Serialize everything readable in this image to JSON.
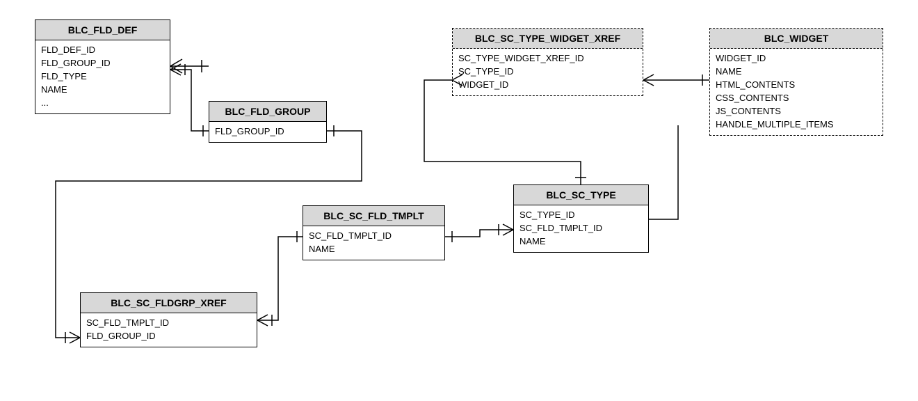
{
  "entities": {
    "fld_def": {
      "title": "BLC_FLD_DEF",
      "fields": [
        "FLD_DEF_ID",
        "FLD_GROUP_ID",
        "FLD_TYPE",
        "NAME",
        "..."
      ]
    },
    "fld_group": {
      "title": "BLC_FLD_GROUP",
      "fields": [
        "FLD_GROUP_ID"
      ]
    },
    "sc_type_widget_xref": {
      "title": "BLC_SC_TYPE_WIDGET_XREF",
      "fields": [
        "SC_TYPE_WIDGET_XREF_ID",
        "SC_TYPE_ID",
        "WIDGET_ID"
      ]
    },
    "widget": {
      "title": "BLC_WIDGET",
      "fields": [
        "WIDGET_ID",
        "NAME",
        "HTML_CONTENTS",
        "CSS_CONTENTS",
        "JS_CONTENTS",
        "HANDLE_MULTIPLE_ITEMS"
      ]
    },
    "sc_fld_tmplt": {
      "title": "BLC_SC_FLD_TMPLT",
      "fields": [
        "SC_FLD_TMPLT_ID",
        "NAME"
      ]
    },
    "sc_type": {
      "title": "BLC_SC_TYPE",
      "fields": [
        "SC_TYPE_ID",
        "SC_FLD_TMPLT_ID",
        "NAME"
      ]
    },
    "sc_fldgrp_xref": {
      "title": "BLC_SC_FLDGRP_XREF",
      "fields": [
        "SC_FLD_TMPLT_ID",
        "FLD_GROUP_ID"
      ]
    }
  }
}
